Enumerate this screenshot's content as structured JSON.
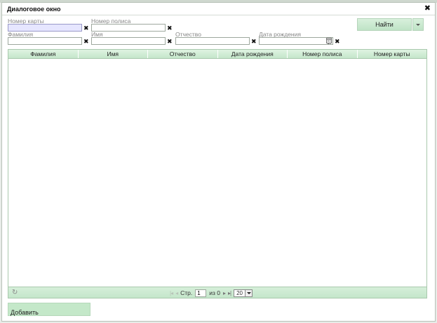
{
  "dialog": {
    "title": "Диалоговое окно",
    "close_glyph": "✖"
  },
  "filters": {
    "card_number": {
      "label": "Номер карты",
      "value": ""
    },
    "policy_number": {
      "label": "Номер полиса",
      "value": ""
    },
    "last_name": {
      "label": "Фамилия",
      "value": ""
    },
    "first_name": {
      "label": "Имя",
      "value": ""
    },
    "patronymic": {
      "label": "Отчество",
      "value": ""
    },
    "birth_date": {
      "label": "Дата рождения",
      "value": ""
    },
    "clear_glyph": "✖"
  },
  "search": {
    "find_label": "Найти"
  },
  "grid": {
    "columns": [
      "Фамилия",
      "Имя",
      "Отчество",
      "Дата рождения",
      "Номер полиса",
      "Номер карты"
    ],
    "rows": []
  },
  "pager": {
    "refresh_glyph": "↻",
    "first_glyph": "|◂",
    "prev_glyph": "◂",
    "page_label": "Стр.",
    "page_value": "1",
    "of_label": "из 0",
    "next_glyph": "▸",
    "last_glyph": "▸|",
    "page_size": "20"
  },
  "footer": {
    "add_label": "Добавить"
  }
}
